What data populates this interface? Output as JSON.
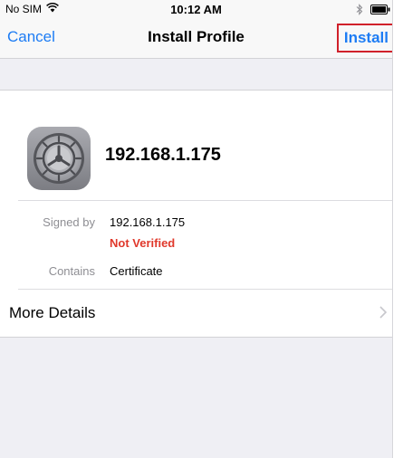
{
  "status_bar": {
    "carrier": "No SIM",
    "time": "10:12 AM",
    "wifi_icon": "wifi-icon",
    "bluetooth_icon": "bluetooth-icon",
    "battery_icon": "battery-icon"
  },
  "nav": {
    "cancel_label": "Cancel",
    "title": "Install Profile",
    "install_label": "Install"
  },
  "profile": {
    "icon": "settings-gear-icon",
    "name": "192.168.1.175",
    "signed_by_label": "Signed by",
    "signed_by_value": "192.168.1.175",
    "verification_status": "Not Verified",
    "contains_label": "Contains",
    "contains_value": "Certificate"
  },
  "more_details": {
    "label": "More Details",
    "chevron_icon": "chevron-right-icon"
  },
  "colors": {
    "tint": "#1d7cf4",
    "warning": "#e0382b",
    "highlight_border": "#d0202a",
    "background": "#efeff4"
  }
}
